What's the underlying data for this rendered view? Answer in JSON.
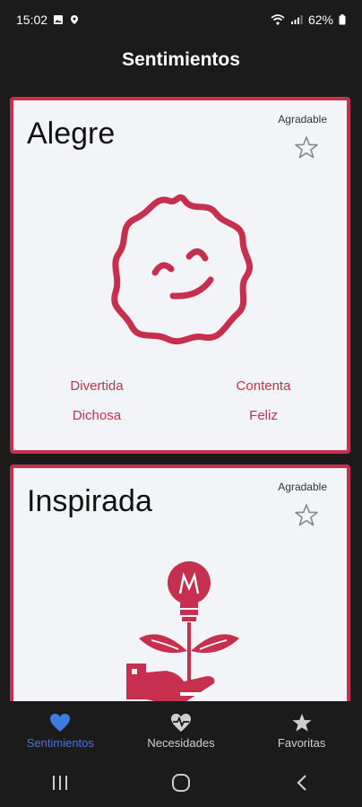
{
  "status_bar": {
    "time": "15:02",
    "battery": "62%"
  },
  "app_bar": {
    "title": "Sentimientos"
  },
  "cards": [
    {
      "title": "Alegre",
      "category": "Agradable",
      "sub_feelings": [
        "Divertida",
        "Contenta",
        "Dichosa",
        "Feliz"
      ]
    },
    {
      "title": "Inspirada",
      "category": "Agradable"
    }
  ],
  "bottom_nav": [
    {
      "label": "Sentimientos",
      "icon": "heart-icon",
      "active": true
    },
    {
      "label": "Necesidades",
      "icon": "heartbeat-icon",
      "active": false
    },
    {
      "label": "Favoritas",
      "icon": "star-icon",
      "active": false
    }
  ],
  "colors": {
    "accent": "#c72f4e",
    "active_nav": "#3d7be0",
    "background": "#1b1b1b",
    "card": "#f3f4f8"
  }
}
